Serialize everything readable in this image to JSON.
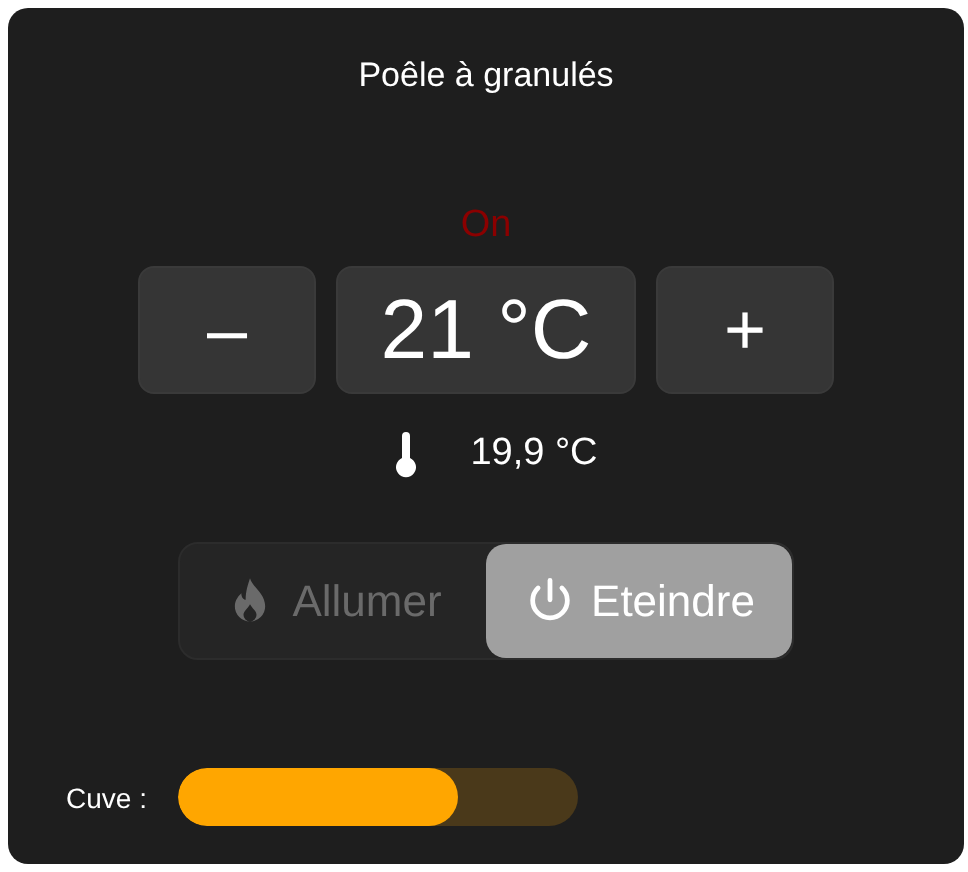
{
  "title": "Poêle à granulés",
  "status": {
    "text": "On",
    "on": true
  },
  "setpoint": {
    "minus": "–",
    "value": "21 °C",
    "plus": "+"
  },
  "current_temperature": "19,9 °C",
  "modes": [
    {
      "label": "Allumer",
      "selected": false
    },
    {
      "label": "Eteindre",
      "selected": true
    }
  ],
  "tank": {
    "label": "Cuve :",
    "level": 0.7
  }
}
